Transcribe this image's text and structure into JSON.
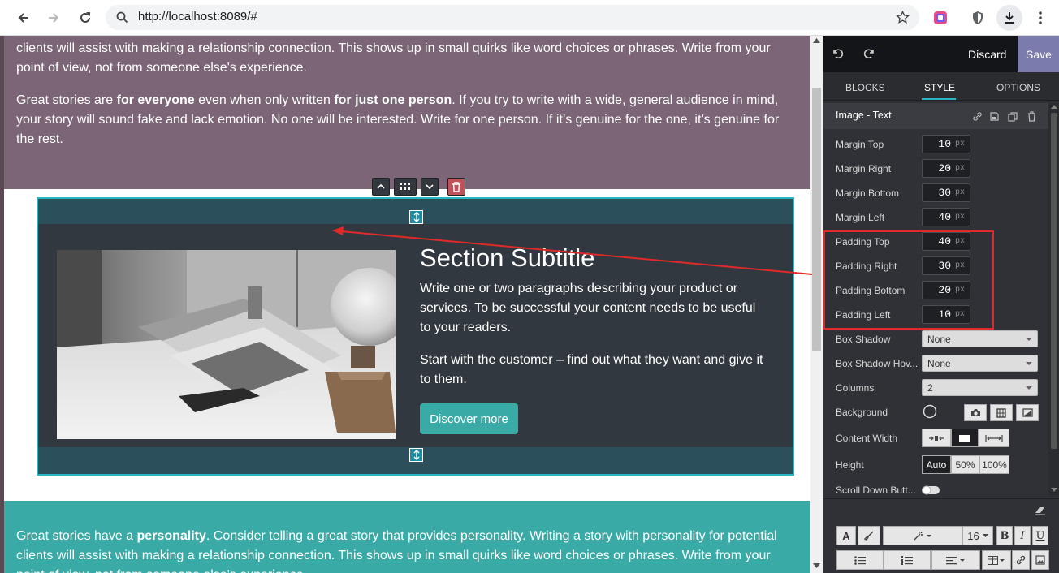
{
  "browser": {
    "url": "http://localhost:8089/#"
  },
  "page": {
    "top_section": {
      "para1_line2": "clients will assist with making a relationship connection. This shows up in small quirks like word choices or phrases. Write from your",
      "para1_line3": "point of view, not from someone else's experience.",
      "para2": {
        "t1": "Great stories are ",
        "b1": "for everyone",
        "t2": " even when only written ",
        "b2": "for just one person",
        "t3": ". If you try to write with a wide, general audience in mind, your story will sound fake and lack emotion. No one will be interested. Write for one person. If it’s genuine for the one, it’s genuine for the rest."
      }
    },
    "image_text_block": {
      "subtitle": "Section Subtitle",
      "paragraph1": "Write one or two paragraphs describing your product or services. To be successful your content needs to be useful to your readers.",
      "paragraph2": "Start with the customer – find out what they want and give it to them.",
      "button_label": "Discover more"
    },
    "bottom_section": {
      "t1": "Great stories have a ",
      "b1": "personality",
      "t2": ". Consider telling a great story that provides personality. Writing a story with personality for potential",
      "line2": "clients will assist with making a relationship connection. This shows up in small quirks like word choices or phrases. Write from your",
      "line3": "point of view, not from someone else's experience."
    }
  },
  "editor": {
    "discard_label": "Discard",
    "save_label": "Save",
    "tabs": [
      "BLOCKS",
      "STYLE",
      "OPTIONS"
    ],
    "active_tab": "STYLE",
    "snippet_title": "Image - Text",
    "spacing": [
      {
        "label": "Margin Top",
        "value": "10",
        "unit": "px"
      },
      {
        "label": "Margin Right",
        "value": "20",
        "unit": "px"
      },
      {
        "label": "Margin Bottom",
        "value": "30",
        "unit": "px"
      },
      {
        "label": "Margin Left",
        "value": "40",
        "unit": "px"
      },
      {
        "label": "Padding Top",
        "value": "40",
        "unit": "px"
      },
      {
        "label": "Padding Right",
        "value": "30",
        "unit": "px"
      },
      {
        "label": "Padding Bottom",
        "value": "20",
        "unit": "px"
      },
      {
        "label": "Padding Left",
        "value": "10",
        "unit": "px"
      }
    ],
    "box_shadow": {
      "label": "Box Shadow",
      "value": "None"
    },
    "box_shadow_hover": {
      "label": "Box Shadow Hov...",
      "value": "None"
    },
    "columns": {
      "label": "Columns",
      "value": "2"
    },
    "background_label": "Background",
    "content_width_label": "Content Width",
    "height": {
      "label": "Height",
      "options": [
        "Auto",
        "50%",
        "100%"
      ]
    },
    "scroll_down_label": "Scroll Down Butt...",
    "font_size": "16",
    "format_buttons": [
      "B",
      "I",
      "U"
    ],
    "text_color_glyph": "A"
  },
  "colors": {
    "purple_section": "#7b6576",
    "teal_section": "#3aaaa6",
    "editor_bg": "#2f3136",
    "save_button": "#7c7bad",
    "selection_border": "#2ab5c5",
    "annotation_red": "#e02a2a"
  }
}
